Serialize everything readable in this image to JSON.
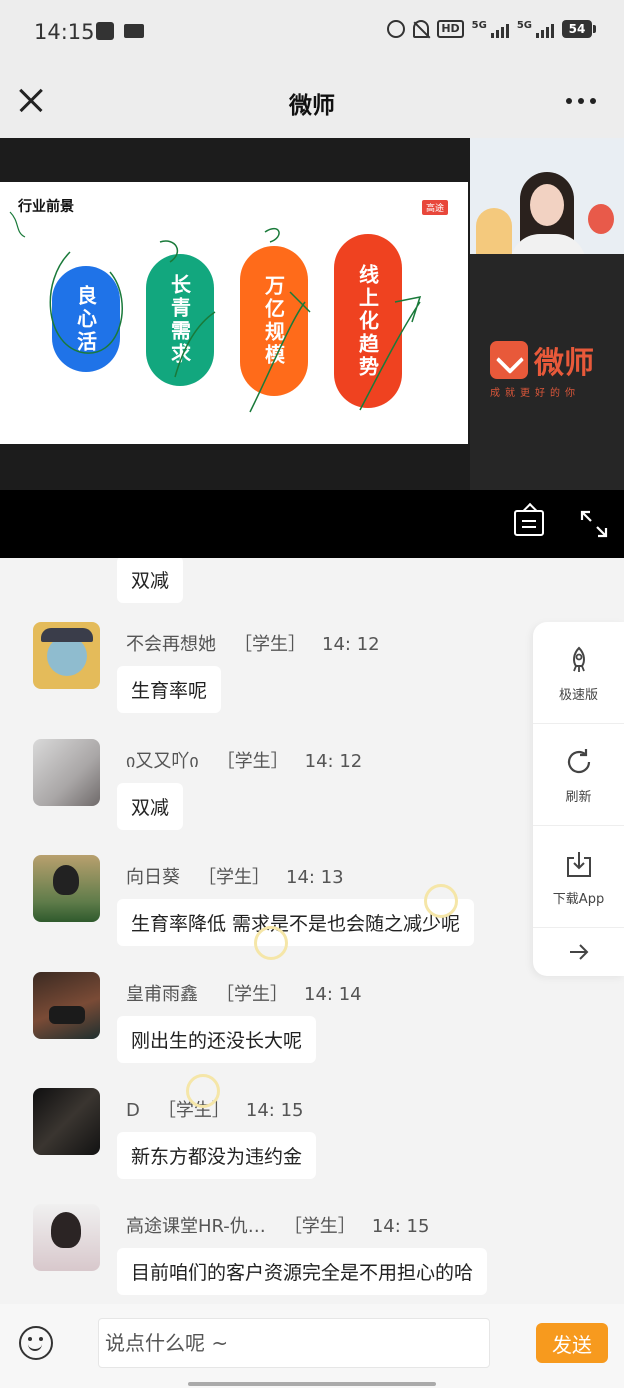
{
  "status_bar": {
    "time": "14:15",
    "hd": "HD",
    "signal_1": "5G",
    "signal_2": "5G",
    "battery": "54"
  },
  "nav": {
    "title": "微师"
  },
  "slide": {
    "title": "行业前景",
    "brand": "高途",
    "pills": [
      "良心活",
      "长青需求",
      "万亿规模",
      "线上化趋势"
    ],
    "colors": [
      "#1f73e8",
      "#12a77e",
      "#ff6b1a",
      "#ef4220"
    ]
  },
  "logo": {
    "name": "微师",
    "slogan": "成就更好的你"
  },
  "chat": {
    "partial_message": "双减",
    "messages": [
      {
        "name": "不会再想她",
        "role": "［学生］",
        "time": "14: 12",
        "text": "生育率呢"
      },
      {
        "name": "ი又又吖ი",
        "role": "［学生］",
        "time": "14: 12",
        "text": "双减"
      },
      {
        "name": "向日葵",
        "role": "［学生］",
        "time": "14: 13",
        "text": "生育率降低 需求是不是也会随之减少呢"
      },
      {
        "name": "皇甫雨鑫",
        "role": "［学生］",
        "time": "14: 14",
        "text": "刚出生的还没长大呢"
      },
      {
        "name": "D",
        "role": "［学生］",
        "time": "14: 15",
        "text": "新东方都没为违约金"
      },
      {
        "name": "高途课堂HR-仇…",
        "role": "［学生］",
        "time": "14: 15",
        "text": "目前咱们的客户资源完全是不用担心的哈"
      }
    ]
  },
  "side_panel": {
    "items": [
      "极速版",
      "刷新",
      "下载App"
    ]
  },
  "input": {
    "placeholder": "说点什么呢 ~",
    "send_label": "发送"
  },
  "colors": {
    "accent": "#f79a1e",
    "logo": "#e8593a"
  }
}
